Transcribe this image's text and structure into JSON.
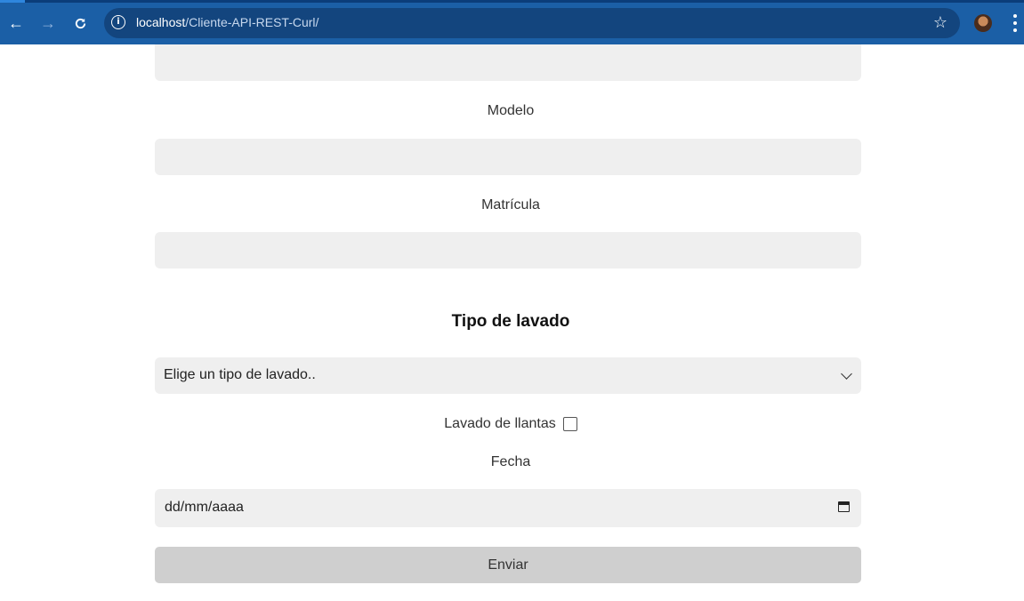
{
  "browser": {
    "url_host": "localhost",
    "url_path": "/Cliente-API-REST-Curl/",
    "back_icon": "arrow-left-icon",
    "forward_icon": "arrow-right-icon",
    "reload_icon": "reload-icon",
    "info_icon": "info-icon",
    "bookmark_icon": "star-icon",
    "menu_icon": "kebab-menu-icon",
    "chrome_color": "#1b5fa6"
  },
  "form": {
    "modelo_label": "Modelo",
    "matricula_label": "Matrícula",
    "tipo_lavado_title": "Tipo de lavado",
    "tipo_lavado_select": "Elige un tipo de lavado..",
    "llantas_label": "Lavado de llantas",
    "llantas_checked": false,
    "fecha_label": "Fecha",
    "fecha_placeholder": "dd/mm/aaaa",
    "submit_label": "Enviar"
  }
}
